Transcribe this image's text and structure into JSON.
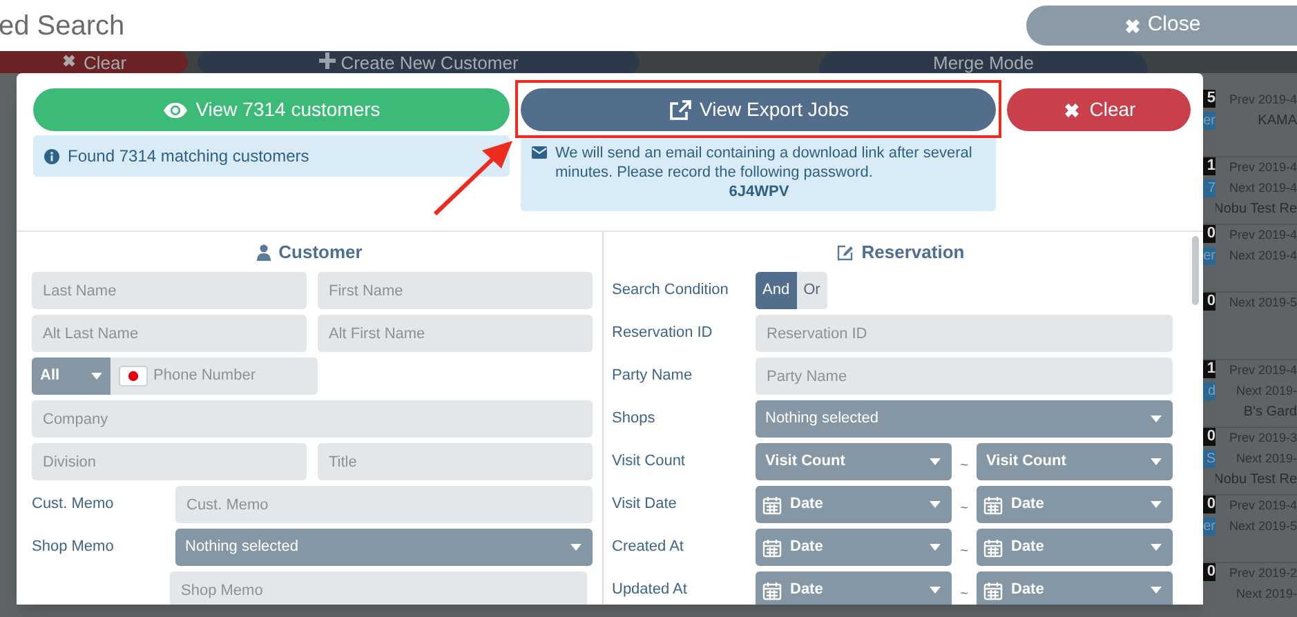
{
  "header": {
    "title": "ed Search",
    "close_button": "Close"
  },
  "toolbar": [
    {
      "label": "Clear",
      "kind": "clear"
    },
    {
      "label": "Create New Customer",
      "kind": "create"
    },
    {
      "label": "Merge Mode",
      "kind": "merge"
    }
  ],
  "results": [
    {
      "count": "5",
      "tag": "er",
      "prev": "Prev 2019-4",
      "name": "KAMA"
    },
    {
      "count": "1",
      "tag": "7",
      "prev": "Prev 2019-4",
      "next": "Next 2019-4",
      "name": "Nobu Test Re"
    },
    {
      "count": "0",
      "tag": "er",
      "prev": "Prev 2019-4",
      "next": "Next 2019-4"
    },
    {
      "count": "0",
      "next": "Next 2019-5"
    },
    {
      "count": "1",
      "tag": "d",
      "prev": "Prev 2019-4",
      "next": "Next 2019-",
      "name": "B's Gard"
    },
    {
      "count": "0",
      "tag": "S",
      "prev": "Prev 2019-3",
      "next": "Next 2019-",
      "name": "Nobu Test Re"
    },
    {
      "count": "0",
      "tag": "er",
      "prev": "Prev 2019-4",
      "next": "Next 2019-5"
    },
    {
      "count": "0",
      "prev": "Prev 2019-2",
      "next": "Next 2019-"
    }
  ],
  "modal": {
    "actions": [
      {
        "label": "View 7314 customers",
        "kind": "view",
        "highlighted": false
      },
      {
        "label": "View Export Jobs",
        "kind": "export",
        "highlighted": true
      },
      {
        "label": "Clear",
        "kind": "clear",
        "highlighted": false
      }
    ],
    "info_alert": "Found 7314 matching customers",
    "email_alert": {
      "message": "We will send an email containing a download link after several minutes. Please record the following password.",
      "password": "6J4WPV"
    },
    "customer": {
      "title": "Customer",
      "rows": [
        {
          "kind": "pair",
          "placeholders": [
            "Last Name",
            "First Name"
          ]
        },
        {
          "kind": "pair",
          "placeholders": [
            "Alt Last Name",
            "Alt First Name"
          ]
        },
        {
          "kind": "phone",
          "select": "All",
          "placeholder": "Phone Number"
        },
        {
          "kind": "single",
          "placeholder": "Company"
        },
        {
          "kind": "pair",
          "placeholders": [
            "Division",
            "Title"
          ]
        },
        {
          "kind": "labeled_input",
          "label": "Cust. Memo",
          "placeholder": "Cust. Memo"
        },
        {
          "kind": "labeled_select",
          "label": "Shop Memo",
          "value": "Nothing selected"
        },
        {
          "kind": "indented_input",
          "placeholder": "Shop Memo"
        }
      ]
    },
    "reservation": {
      "title": "Reservation",
      "rows": [
        {
          "kind": "toggle",
          "label": "Search Condition",
          "options": [
            {
              "label": "And",
              "selected": true
            },
            {
              "label": "Or",
              "selected": false
            }
          ]
        },
        {
          "kind": "input",
          "label": "Reservation ID",
          "placeholder": "Reservation ID"
        },
        {
          "kind": "input",
          "label": "Party Name",
          "placeholder": "Party Name"
        },
        {
          "kind": "select",
          "label": "Shops",
          "value": "Nothing selected"
        },
        {
          "kind": "range",
          "label": "Visit Count",
          "from": "Visit Count",
          "to": "Visit Count",
          "separator": "~"
        },
        {
          "kind": "date_range",
          "label": "Visit Date",
          "from": "Date",
          "to": "Date",
          "separator": "~"
        },
        {
          "kind": "date_range",
          "label": "Created At",
          "from": "Date",
          "to": "Date",
          "separator": "~"
        },
        {
          "kind": "date_range",
          "label": "Updated At",
          "from": "Date",
          "to": "Date",
          "separator": "~"
        }
      ]
    }
  }
}
